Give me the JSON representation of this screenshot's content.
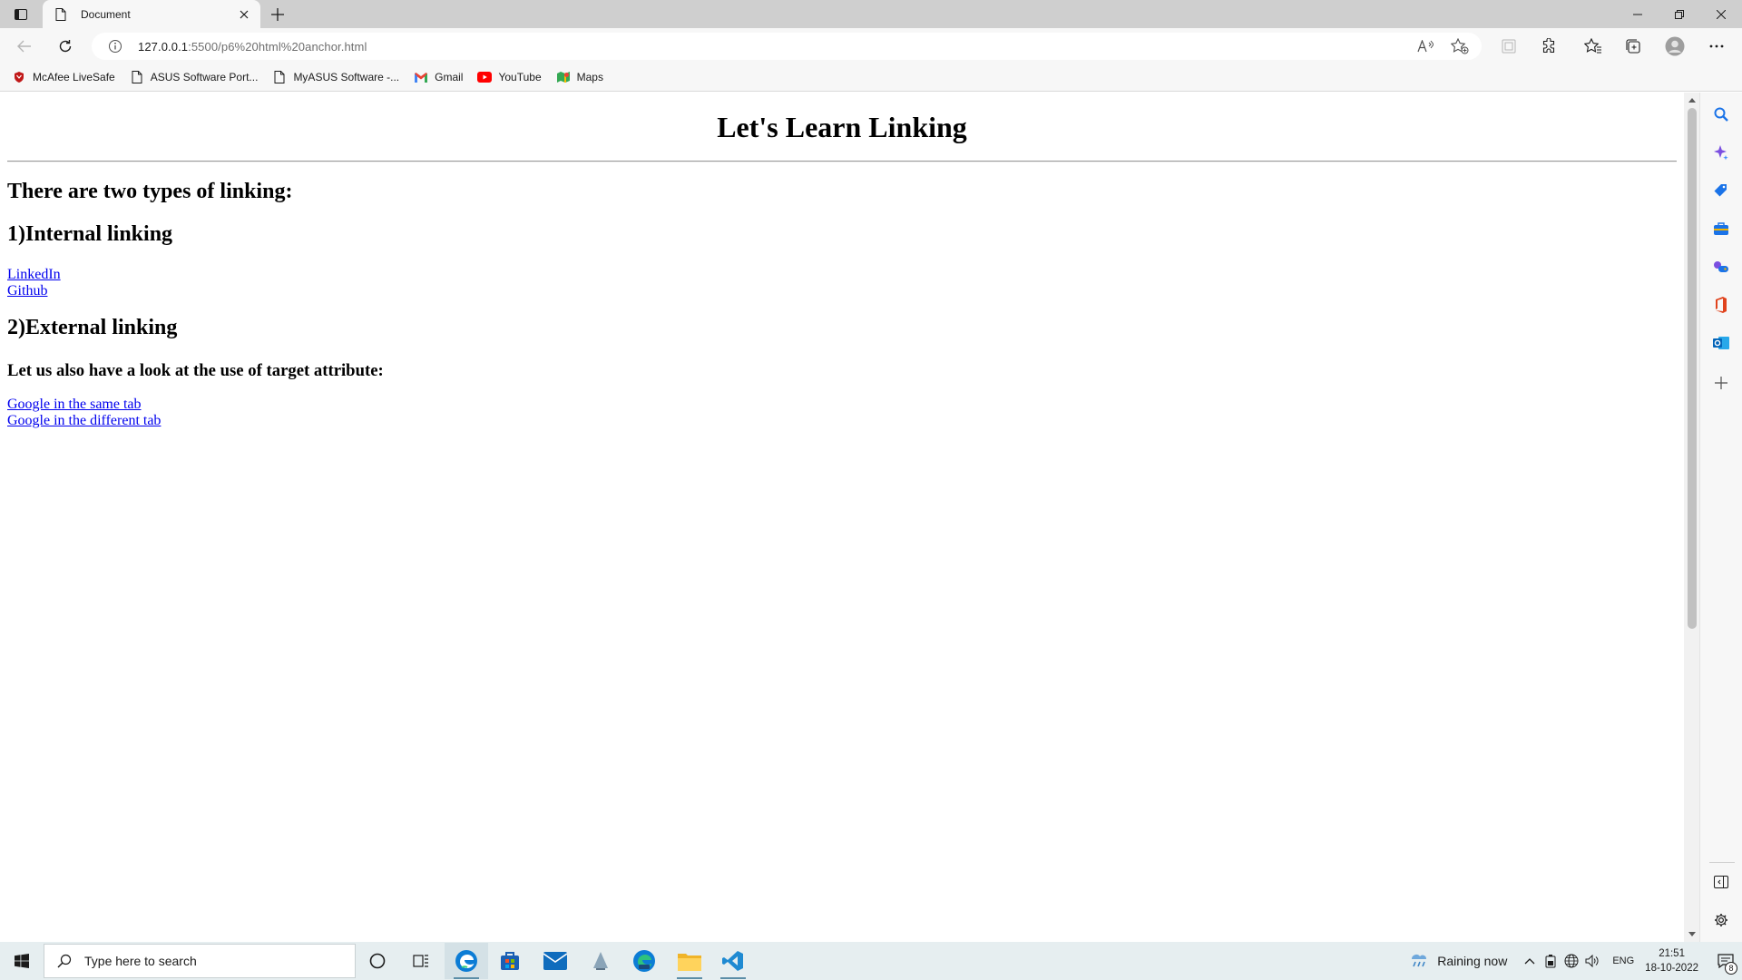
{
  "browser": {
    "tab": {
      "title": "Document"
    },
    "address": {
      "url_host": "127.0.0.1",
      "url_rest": ":5500/p6%20html%20anchor.html"
    },
    "favorites": [
      {
        "label": "McAfee LiveSafe",
        "icon": "mcafee-icon"
      },
      {
        "label": "ASUS Software Port...",
        "icon": "page-icon"
      },
      {
        "label": "MyASUS Software -...",
        "icon": "page-icon"
      },
      {
        "label": "Gmail",
        "icon": "gmail-icon"
      },
      {
        "label": "YouTube",
        "icon": "youtube-icon"
      },
      {
        "label": "Maps",
        "icon": "maps-icon"
      }
    ]
  },
  "page": {
    "title": "Let's Learn Linking",
    "intro": "There are two types of linking:",
    "internal_heading": "1)Internal linking",
    "internal_links": [
      "LinkedIn",
      "Github"
    ],
    "external_heading": "2)External linking",
    "target_heading": "Let us also have a look at the use of target attribute:",
    "target_links": [
      "Google in the same tab",
      "Google in the different tab"
    ]
  },
  "taskbar": {
    "search_placeholder": "Type here to search",
    "weather": "Raining now",
    "language": "ENG",
    "time": "21:51",
    "date": "18-10-2022",
    "notification_count": "8"
  },
  "colors": {
    "link": "#0000ee",
    "edge_accent": "#1a73e8",
    "taskbar": "#e6eef0"
  }
}
